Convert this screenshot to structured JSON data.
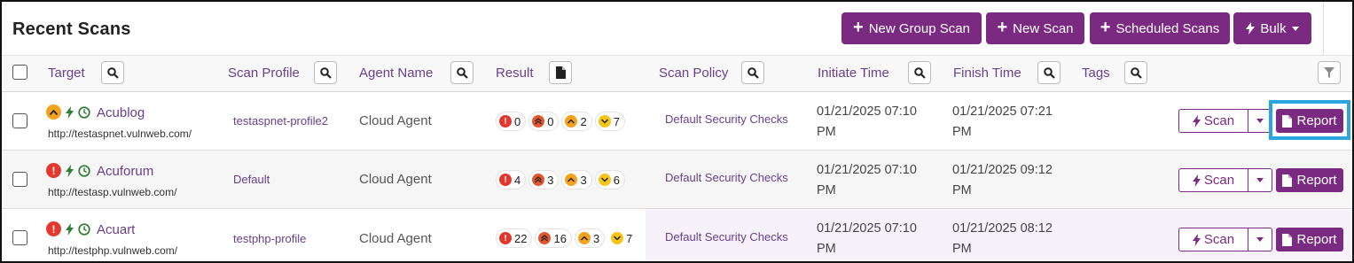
{
  "header": {
    "title": "Recent Scans",
    "buttons": {
      "new_group_scan": "New Group Scan",
      "new_scan": "New Scan",
      "scheduled_scans": "Scheduled Scans",
      "bulk": "Bulk"
    }
  },
  "columns": {
    "target": "Target",
    "scan_profile": "Scan Profile",
    "agent_name": "Agent Name",
    "result": "Result",
    "scan_policy": "Scan Policy",
    "initiate_time": "Initiate Time",
    "finish_time": "Finish Time",
    "tags": "Tags"
  },
  "rows": [
    {
      "status_icons": [
        "chevron-up-icon",
        "bolt-icon",
        "clock-icon"
      ],
      "target_name": "Acublog",
      "target_url": "http://testaspnet.vulnweb.com/",
      "scan_profile": "testaspnet-profile2",
      "agent": "Cloud Agent",
      "results": {
        "critical": "0",
        "high": "0",
        "medium": "2",
        "low": "7"
      },
      "policy": "Default Security Checks",
      "initiate_date": "01/21/2025 07:10",
      "initiate_ampm": "PM",
      "finish_date": "01/21/2025 07:21",
      "finish_ampm": "PM",
      "scan_label": "Scan",
      "report_label": "Report"
    },
    {
      "status_icons": [
        "exclamation-icon",
        "bolt-icon",
        "clock-icon"
      ],
      "target_name": "Acuforum",
      "target_url": "http://testasp.vulnweb.com/",
      "scan_profile": "Default",
      "agent": "Cloud Agent",
      "results": {
        "critical": "4",
        "high": "3",
        "medium": "3",
        "low": "6"
      },
      "policy": "Default Security Checks",
      "initiate_date": "01/21/2025 07:10",
      "initiate_ampm": "PM",
      "finish_date": "01/21/2025 09:12",
      "finish_ampm": "PM",
      "scan_label": "Scan",
      "report_label": "Report"
    },
    {
      "status_icons": [
        "exclamation-icon",
        "bolt-icon",
        "clock-icon"
      ],
      "target_name": "Acuart",
      "target_url": "http://testphp.vulnweb.com/",
      "scan_profile": "testphp-profile",
      "agent": "Cloud Agent",
      "results": {
        "critical": "22",
        "high": "16",
        "medium": "3",
        "low": "7"
      },
      "policy": "Default Security Checks",
      "initiate_date": "01/21/2025 07:10",
      "initiate_ampm": "PM",
      "finish_date": "01/21/2025 08:12",
      "finish_ampm": "PM",
      "scan_label": "Scan",
      "report_label": "Report"
    }
  ],
  "colors": {
    "accent_purple": "#7b2a82",
    "link_purple": "#6a3f8c",
    "critical_red": "#e4372e",
    "high_orange": "#e4572e",
    "medium_orange": "#f2a21b",
    "low_yellow": "#f5c518",
    "focus_blue": "#2aa5df"
  }
}
